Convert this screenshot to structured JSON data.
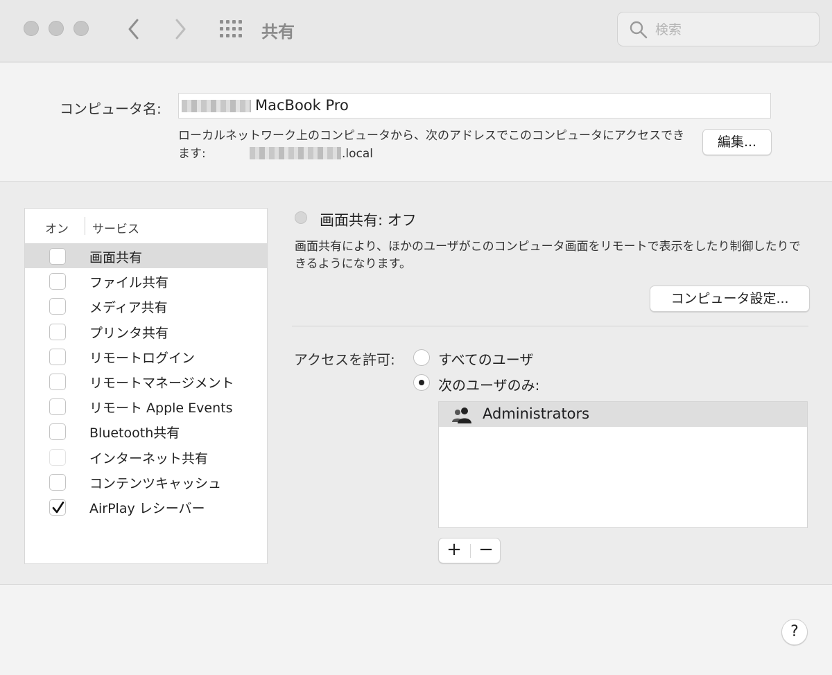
{
  "window": {
    "title": "共有",
    "search_placeholder": "検索"
  },
  "computer_name": {
    "label": "コンピュータ名:",
    "value": "MacBook Pro",
    "address_text": "ローカルネットワーク上のコンピュータから、次のアドレスでこのコンピュータにアクセスできます:",
    "address_suffix": ".local",
    "edit_button": "編集..."
  },
  "services": {
    "header_on": "オン",
    "header_service": "サービス",
    "items": [
      {
        "label": "画面共有",
        "checked": false,
        "selected": true,
        "enabled": true
      },
      {
        "label": "ファイル共有",
        "checked": false,
        "selected": false,
        "enabled": true
      },
      {
        "label": "メディア共有",
        "checked": false,
        "selected": false,
        "enabled": true
      },
      {
        "label": "プリンタ共有",
        "checked": false,
        "selected": false,
        "enabled": true
      },
      {
        "label": "リモートログイン",
        "checked": false,
        "selected": false,
        "enabled": true
      },
      {
        "label": "リモートマネージメント",
        "checked": false,
        "selected": false,
        "enabled": true
      },
      {
        "label": "リモート Apple Events",
        "checked": false,
        "selected": false,
        "enabled": true
      },
      {
        "label": "Bluetooth共有",
        "checked": false,
        "selected": false,
        "enabled": true
      },
      {
        "label": "インターネット共有",
        "checked": false,
        "selected": false,
        "enabled": false
      },
      {
        "label": "コンテンツキャッシュ",
        "checked": false,
        "selected": false,
        "enabled": true
      },
      {
        "label": "AirPlay レシーバー",
        "checked": true,
        "selected": false,
        "enabled": true
      }
    ]
  },
  "detail": {
    "status": "画面共有: オフ",
    "description": "画面共有により、ほかのユーザがこのコンピュータ画面をリモートで表示をしたり制御したりできるようになります。",
    "settings_button": "コンピュータ設定...",
    "access_label": "アクセスを許可:",
    "access_all": "すべてのユーザ",
    "access_only": "次のユーザのみ:",
    "users": [
      "Administrators"
    ],
    "add_button": "+",
    "remove_button": "−"
  },
  "help_button": "?"
}
